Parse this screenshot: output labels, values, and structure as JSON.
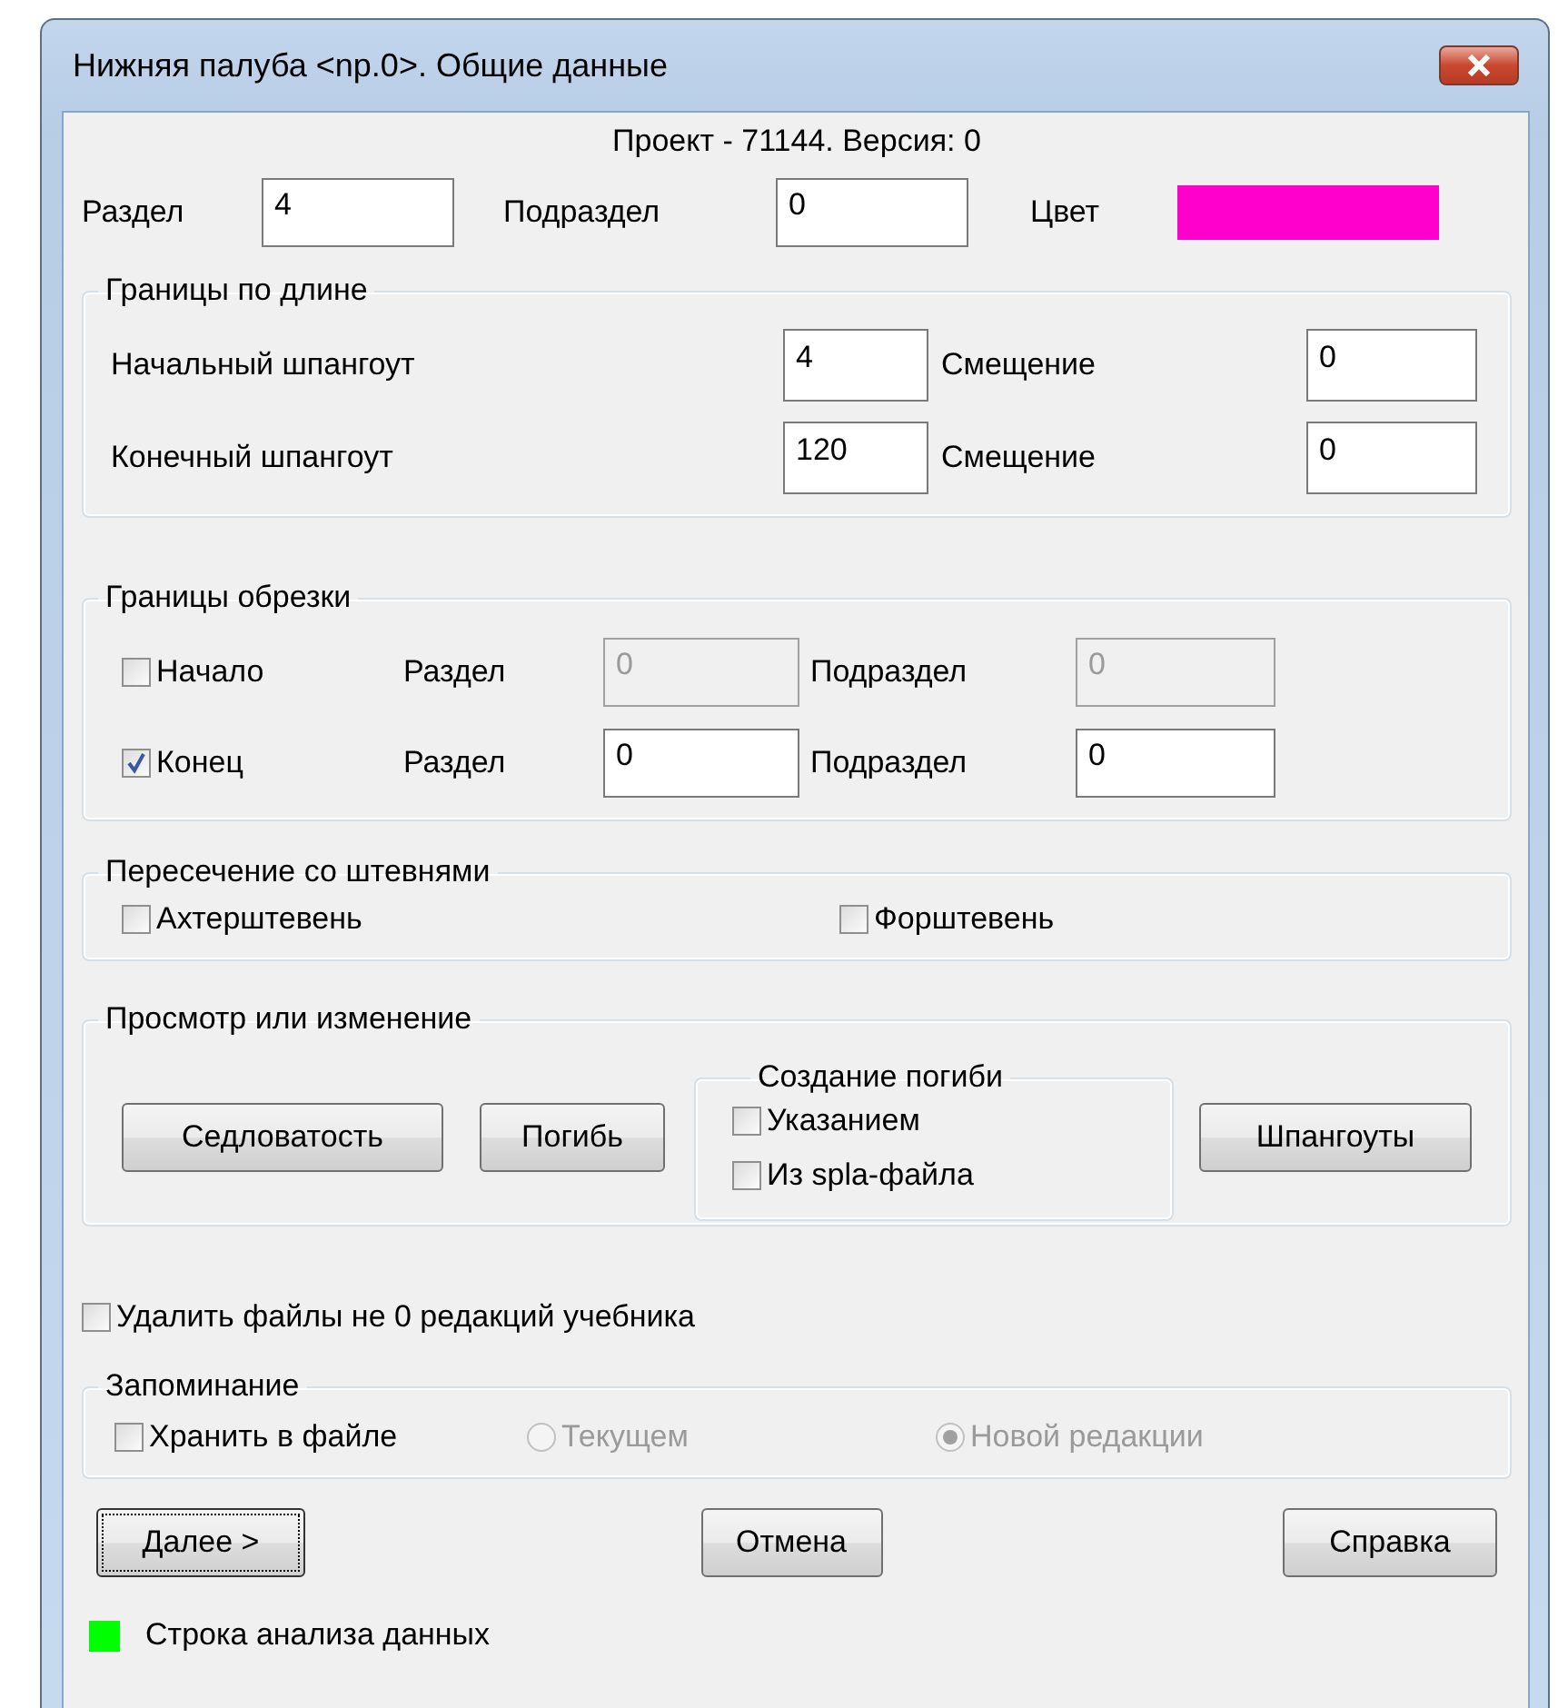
{
  "window": {
    "title": "Нижняя палуба <np.0>. Общие данные"
  },
  "project_line": "Проект - 71144. Версия: 0",
  "top_row": {
    "section_label": "Раздел",
    "section_value": "4",
    "subsection_label": "Подраздел",
    "subsection_value": "0",
    "color_label": "Цвет",
    "color": "#ff00cc"
  },
  "length_bounds": {
    "title": "Границы по длине",
    "rows": [
      {
        "label": "Начальный шпангоут",
        "value": "4",
        "offset_label": "Смещение",
        "offset_value": "0"
      },
      {
        "label": "Конечный шпангоут",
        "value": "120",
        "offset_label": "Смещение",
        "offset_value": "0"
      }
    ]
  },
  "trim_bounds": {
    "title": "Границы обрезки",
    "rows": [
      {
        "label": "Начало",
        "checked": false,
        "disabled": true,
        "section_label": "Раздел",
        "section_value": "0",
        "subsection_label": "Подраздел",
        "subsection_value": "0"
      },
      {
        "label": "Конец",
        "checked": true,
        "disabled": false,
        "section_label": "Раздел",
        "section_value": "0",
        "subsection_label": "Подраздел",
        "subsection_value": "0"
      }
    ]
  },
  "stems": {
    "title": "Пересечение со штевнями",
    "items": [
      {
        "label": "Ахтерштевень",
        "checked": false
      },
      {
        "label": "Форштевень",
        "checked": false
      }
    ]
  },
  "view_edit": {
    "title": "Просмотр или изменение",
    "buttons": [
      "Седловатость",
      "Погибь"
    ],
    "bend_group": {
      "title": "Создание погиби",
      "options": [
        {
          "label": "Указанием",
          "checked": false
        },
        {
          "label": "Из spla-файла",
          "checked": false
        }
      ]
    },
    "last_button": "Шпангоуты"
  },
  "delete_option": {
    "label": "Удалить файлы не 0 редакций учебника",
    "checked": false
  },
  "memory": {
    "title": "Запоминание",
    "store": {
      "label": "Хранить в файле",
      "checked": false
    },
    "radios": [
      {
        "label": "Текущем",
        "selected": false,
        "disabled": true
      },
      {
        "label": "Новой редакции",
        "selected": true,
        "disabled": true
      }
    ]
  },
  "footer_buttons": [
    {
      "label": "Далее >",
      "focused": true
    },
    {
      "label": "Отмена",
      "focused": false
    },
    {
      "label": "Справка",
      "focused": false
    }
  ],
  "status": {
    "color": "#00ff00",
    "label": "Строка анализа данных"
  }
}
